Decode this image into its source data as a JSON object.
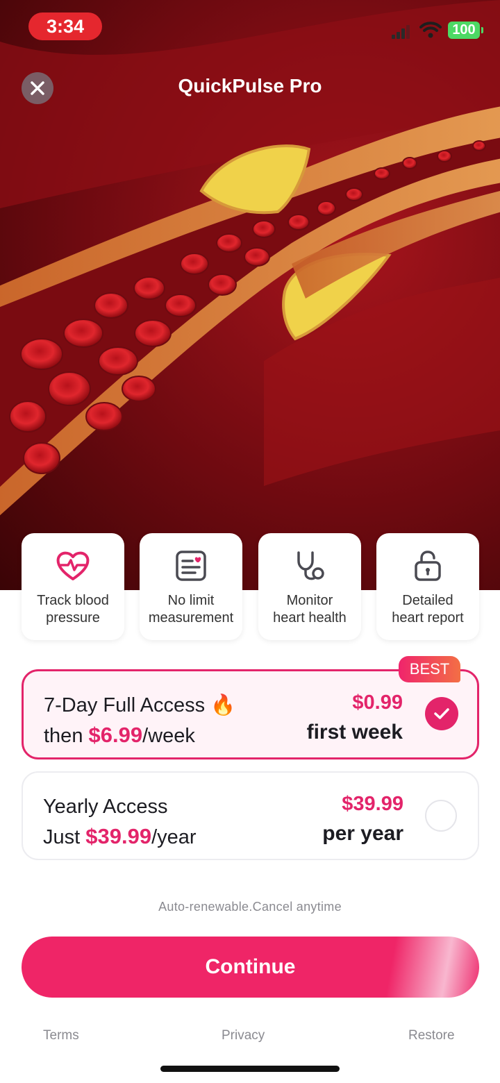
{
  "status_bar": {
    "time": "3:34",
    "battery": "100",
    "time_pill_color": "#e5272e"
  },
  "header": {
    "title": "QuickPulse Pro",
    "close_icon": "close-icon"
  },
  "features": [
    {
      "icon": "heart-pulse-icon",
      "label": "Track blood\npressure"
    },
    {
      "icon": "report-card-icon",
      "label": "No limit\nmeasurement"
    },
    {
      "icon": "stethoscope-icon",
      "label": "Monitor\nheart health"
    },
    {
      "icon": "unlock-icon",
      "label": "Detailed\nheart report"
    }
  ],
  "plans": {
    "weekly": {
      "badge": "BEST",
      "title": "7-Day Full Access",
      "title_emoji": "🔥",
      "then_prefix": "then ",
      "then_price": "$6.99",
      "then_suffix": "/week",
      "price": "$0.99",
      "period": "first week",
      "selected": true
    },
    "yearly": {
      "title": "Yearly Access",
      "just_prefix": "Just ",
      "just_price": "$39.99",
      "just_suffix": "/year",
      "price": "$39.99",
      "period": "per year",
      "selected": false
    }
  },
  "auto_note": "Auto-renewable.Cancel anytime",
  "continue_label": "Continue",
  "footer": {
    "terms": "Terms",
    "privacy": "Privacy",
    "restore": "Restore"
  },
  "colors": {
    "accent": "#e3246a",
    "button": "#ef2567"
  }
}
